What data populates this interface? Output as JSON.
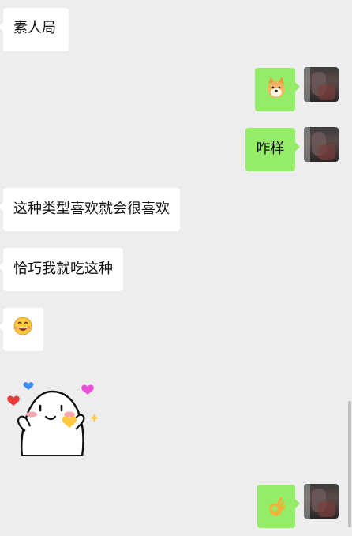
{
  "messages": [
    {
      "side": "in",
      "type": "text",
      "text": "素人局"
    },
    {
      "side": "out",
      "type": "emoji",
      "emoji": "dog-emoji"
    },
    {
      "side": "out",
      "type": "text",
      "text": "咋样"
    },
    {
      "side": "in",
      "type": "text",
      "text": "这种类型喜欢就会很喜欢"
    },
    {
      "side": "in",
      "type": "text",
      "text": "恰巧我就吃这种"
    },
    {
      "side": "in",
      "type": "emoji",
      "emoji": "grin-emoji"
    },
    {
      "side": "in",
      "type": "sticker",
      "sticker": "love-sticker"
    },
    {
      "side": "out",
      "type": "emoji",
      "emoji": "ok-hand-emoji"
    }
  ],
  "colors": {
    "background": "#EDEDED",
    "incoming_bubble": "#FFFFFF",
    "outgoing_bubble": "#95EC69"
  }
}
